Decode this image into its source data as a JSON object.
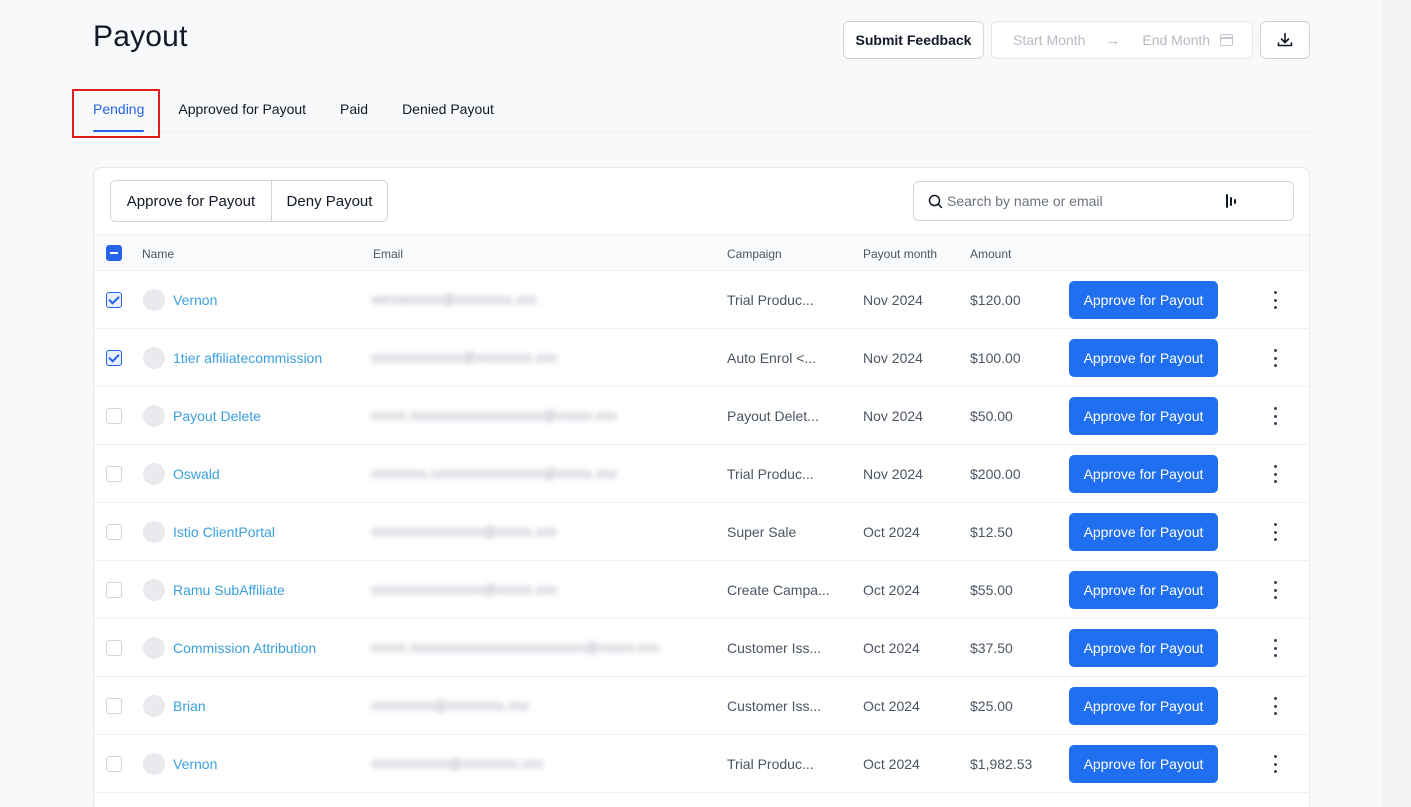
{
  "header": {
    "title": "Payout",
    "feedback_label": "Submit Feedback",
    "date_range": {
      "start_placeholder": "Start Month",
      "end_placeholder": "End Month"
    }
  },
  "tabs": [
    {
      "label": "Pending",
      "active": true
    },
    {
      "label": "Approved for Payout",
      "active": false
    },
    {
      "label": "Paid",
      "active": false
    },
    {
      "label": "Denied Payout",
      "active": false
    }
  ],
  "toolbar": {
    "approve_label": "Approve for Payout",
    "deny_label": "Deny Payout",
    "search_placeholder": "Search by name or email"
  },
  "table": {
    "columns": {
      "name": "Name",
      "email": "Email",
      "campaign": "Campaign",
      "payout_month": "Payout month",
      "amount": "Amount"
    },
    "action_label": "Approve for Payout",
    "rows": [
      {
        "checked": true,
        "name": "Vernon",
        "email": "vernonxxxx@xxxxxxxx.xxx",
        "campaign": "Trial Produc...",
        "month": "Nov 2024",
        "amount": "$120.00"
      },
      {
        "checked": true,
        "name": "1tier affiliatecommission",
        "email": "xxxxxxxxxxxxx@xxxxxxxx.xxx",
        "campaign": "Auto Enrol <...",
        "month": "Nov 2024",
        "amount": "$100.00"
      },
      {
        "checked": false,
        "name": "Payout Delete",
        "email": "xxxxx.xxxxxxxxxxxxxxxxxxx@xxxxx.xxx",
        "campaign": "Payout Delet...",
        "month": "Nov 2024",
        "amount": "$50.00"
      },
      {
        "checked": false,
        "name": "Oswald",
        "email": "xxxxxxxx.xxxxxxxxxxxxxxxx@xxxxx.xxx",
        "campaign": "Trial Produc...",
        "month": "Nov 2024",
        "amount": "$200.00"
      },
      {
        "checked": false,
        "name": "Istio ClientPortal",
        "email": "xxxxxxxxxxxxxxxx@xxxxx.xxx",
        "campaign": "Super Sale",
        "month": "Oct 2024",
        "amount": "$12.50"
      },
      {
        "checked": false,
        "name": "Ramu SubAffiliate",
        "email": "xxxxxxxxxxxxxxxx@xxxxx.xxx",
        "campaign": "Create Campa...",
        "month": "Oct 2024",
        "amount": "$55.00"
      },
      {
        "checked": false,
        "name": "Commission Attribution",
        "email": "xxxxx.xxxxxxxxxxxxxxxxxxxxxxxxx@xxxxx.xxx",
        "campaign": "Customer Iss...",
        "month": "Oct 2024",
        "amount": "$37.50"
      },
      {
        "checked": false,
        "name": "Brian",
        "email": "xxxxxxxxx@xxxxxxxx.xxx",
        "campaign": "Customer Iss...",
        "month": "Oct 2024",
        "amount": "$25.00"
      },
      {
        "checked": false,
        "name": "Vernon",
        "email": "xxxxxxxxxxx@xxxxxxxx.xxx",
        "campaign": "Trial Produc...",
        "month": "Oct 2024",
        "amount": "$1,982.53"
      }
    ]
  },
  "colors": {
    "primary": "#1f6ff0",
    "link": "#3b9fdc",
    "highlight": "#e11d1d"
  },
  "icons": {
    "download": "download-icon",
    "search": "search-icon",
    "filter": "filter-icon",
    "calendar": "calendar-icon",
    "arrow": "arrow-right-icon",
    "kebab": "more-vertical-icon"
  }
}
